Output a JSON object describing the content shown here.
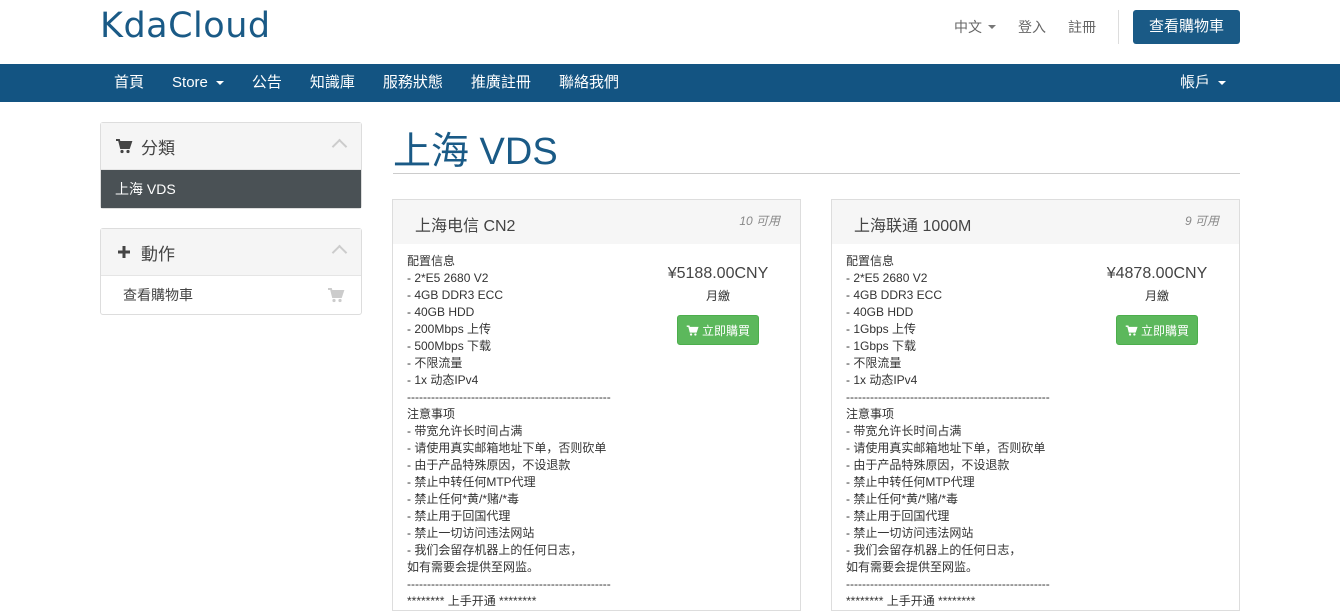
{
  "header": {
    "logo": "KdaCloud",
    "language": "中文",
    "login": "登入",
    "register": "註冊",
    "view_cart": "查看購物車"
  },
  "nav": {
    "items": [
      {
        "label": "首頁"
      },
      {
        "label": "Store"
      },
      {
        "label": "公告"
      },
      {
        "label": "知識庫"
      },
      {
        "label": "服務狀態"
      },
      {
        "label": "推廣註冊"
      },
      {
        "label": "聯絡我們"
      }
    ],
    "account": "帳戶"
  },
  "sidebar": {
    "categories_title": "分類",
    "categories": [
      {
        "label": "上海 VDS"
      }
    ],
    "actions_title": "動作",
    "actions": [
      {
        "label": "查看購物車"
      }
    ]
  },
  "page": {
    "title": "上海 VDS"
  },
  "products": [
    {
      "name": "上海电信 CN2",
      "qty": "10 可用",
      "price": "¥5188.00CNY",
      "cycle": "月繳",
      "buy": "立即購買",
      "desc": [
        "配置信息",
        "- 2*E5 2680 V2",
        "- 4GB DDR3 ECC",
        "- 40GB HDD",
        "- 200Mbps 上传",
        "- 500Mbps 下载",
        "- 不限流量",
        "- 1x 动态IPv4",
        "---------------------------------------------------",
        "注意事项",
        "- 带宽允许长时间占满",
        "- 请使用真实邮箱地址下单，否则砍单",
        "- 由于产品特殊原因，不设退款",
        "- 禁止中转任何MTP代理",
        "- 禁止任何*黄/*赌/*毒",
        "- 禁止用于回国代理",
        "- 禁止一切访问违法网站",
        "- 我们会留存机器上的任何日志，",
        "如有需要会提供至网监。",
        "---------------------------------------------------",
        "******** 上手开通 ********"
      ]
    },
    {
      "name": "上海联通 1000M",
      "qty": "9 可用",
      "price": "¥4878.00CNY",
      "cycle": "月繳",
      "buy": "立即購買",
      "desc": [
        "配置信息",
        "- 2*E5 2680 V2",
        "- 4GB DDR3 ECC",
        "- 40GB HDD",
        "- 1Gbps 上传",
        "- 1Gbps 下载",
        "- 不限流量",
        "- 1x 动态IPv4",
        "---------------------------------------------------",
        "注意事项",
        "- 带宽允许长时间占满",
        "- 请使用真实邮箱地址下单，否则砍单",
        "- 由于产品特殊原因，不设退款",
        "- 禁止中转任何MTP代理",
        "- 禁止任何*黄/*赌/*毒",
        "- 禁止用于回国代理",
        "- 禁止一切访问违法网站",
        "- 我们会留存机器上的任何日志，",
        "如有需要会提供至网监。",
        "---------------------------------------------------",
        "******** 上手开通 ********"
      ]
    }
  ],
  "colors": {
    "brand": "#1a5a86",
    "navbar": "#135482",
    "buy_button": "#5cb85c",
    "active_category": "#4a5155"
  }
}
